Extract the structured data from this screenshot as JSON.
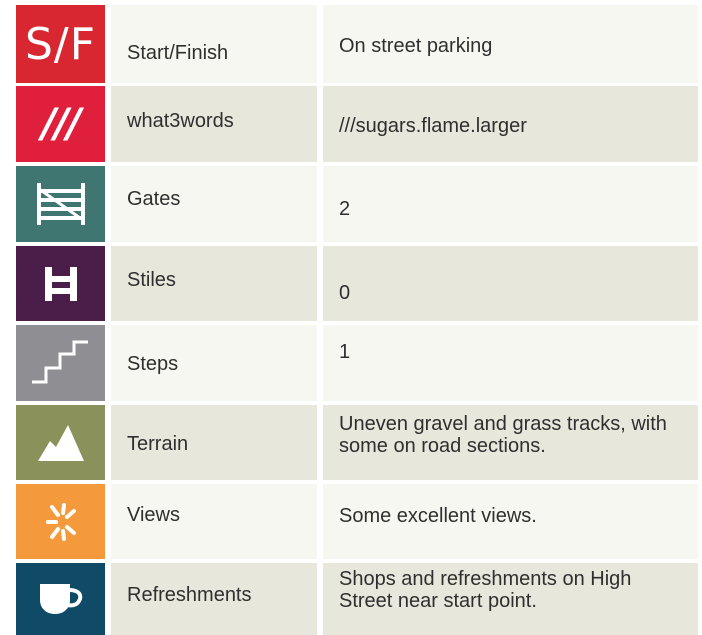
{
  "rows": [
    {
      "label": "Start/Finish",
      "value": "On street parking",
      "icon": "start-finish-icon",
      "icon_text": "S/F",
      "color": "#d82730"
    },
    {
      "label": "what3words",
      "value": "///sugars.flame.larger",
      "icon": "what3words-icon",
      "icon_text": "///",
      "color": "#e01f3d"
    },
    {
      "label": "Gates",
      "value": "2",
      "icon": "gate-icon",
      "color": "#3f7672"
    },
    {
      "label": "Stiles",
      "value": "0",
      "icon": "stile-icon",
      "color": "#4b1e4a"
    },
    {
      "label": "Steps",
      "value": "1",
      "icon": "steps-icon",
      "color": "#8f8f93"
    },
    {
      "label": "Terrain",
      "value": "Uneven gravel and grass tracks, with some on road sections.",
      "icon": "mountain-icon",
      "color": "#8a915b"
    },
    {
      "label": "Views",
      "value": "Some excellent views.",
      "icon": "views-icon",
      "color": "#f59a3c"
    },
    {
      "label": "Refreshments",
      "value": "Shops and refreshments on High Street near start point.",
      "icon": "cup-icon",
      "color": "#0f4a67"
    }
  ]
}
